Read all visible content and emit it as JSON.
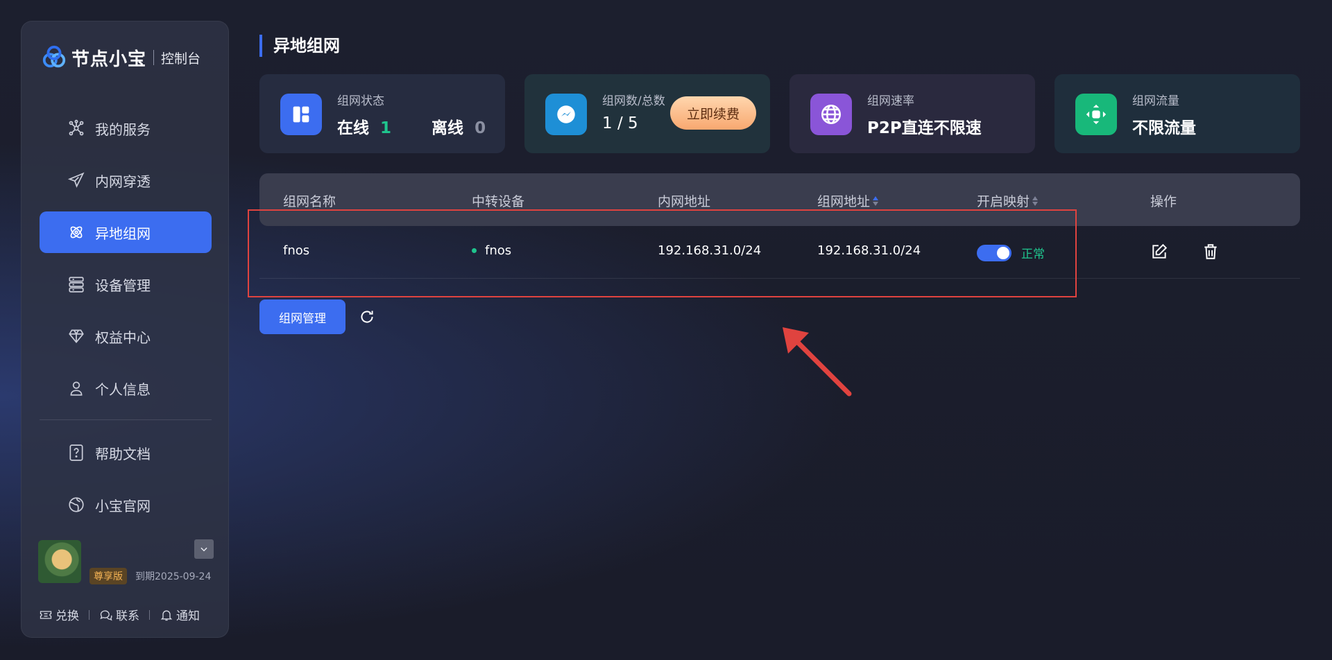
{
  "brand": {
    "name": "节点小宝",
    "sub": "控制台"
  },
  "nav": [
    {
      "label": "我的服务",
      "icon": "network-nodes-icon"
    },
    {
      "label": "内网穿透",
      "icon": "paper-plane-icon"
    },
    {
      "label": "异地组网",
      "icon": "atom-icon",
      "active": true
    },
    {
      "label": "设备管理",
      "icon": "server-icon"
    },
    {
      "label": "权益中心",
      "icon": "diamond-icon"
    },
    {
      "label": "个人信息",
      "icon": "user-icon"
    },
    {
      "label": "帮助文档",
      "icon": "help-doc-icon"
    },
    {
      "label": "小宝官网",
      "icon": "globe-icon"
    }
  ],
  "user": {
    "badge": "尊享版",
    "expire": "到期2025-09-24"
  },
  "bottom_links": {
    "redeem": "兑换",
    "contact": "联系",
    "notify": "通知"
  },
  "page": {
    "title": "异地组网"
  },
  "cards": {
    "status": {
      "label": "组网状态",
      "online_label": "在线",
      "online": "1",
      "offline_label": "离线",
      "offline": "0"
    },
    "count": {
      "label": "组网数/总数",
      "value": "1 / 5",
      "renew": "立即续费"
    },
    "speed": {
      "label": "组网速率",
      "value": "P2P直连不限速"
    },
    "traffic": {
      "label": "组网流量",
      "value": "不限流量"
    }
  },
  "table": {
    "headers": {
      "name": "组网名称",
      "relay": "中转设备",
      "lan": "内网地址",
      "net": "组网地址",
      "map": "开启映射",
      "ops": "操作"
    },
    "rows": [
      {
        "name": "fnos",
        "relay": "fnos",
        "lan": "192.168.31.0/24",
        "net": "192.168.31.0/24",
        "status": "正常"
      }
    ]
  },
  "actions": {
    "manage": "组网管理"
  },
  "colors": {
    "accent": "#3c6df0",
    "success": "#1fc48d",
    "highlight": "#e0433f"
  }
}
